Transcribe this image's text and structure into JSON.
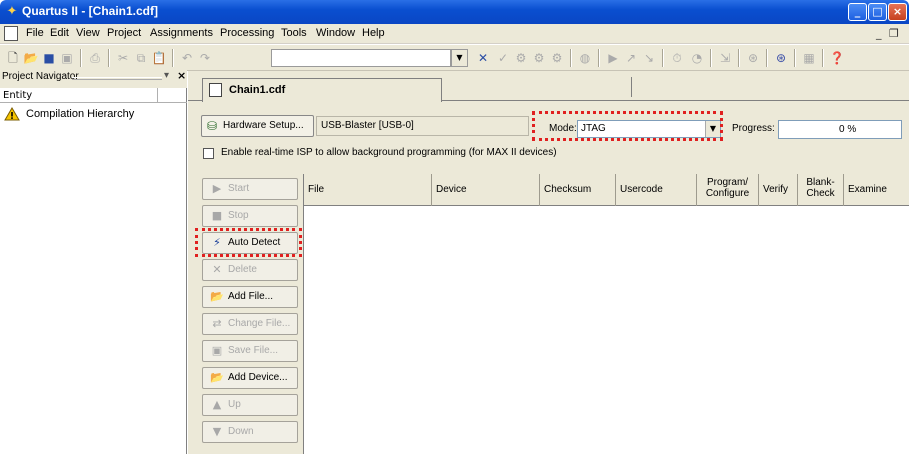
{
  "window": {
    "title": "Quartus II - [Chain1.cdf]"
  },
  "menu": [
    "File",
    "Edit",
    "View",
    "Project",
    "Assignments",
    "Processing",
    "Tools",
    "Window",
    "Help"
  ],
  "navigator": {
    "title": "Project Navigator",
    "column": "Entity",
    "items": [
      {
        "label": "Compilation Hierarchy",
        "icon": "warning-triangle-icon"
      }
    ]
  },
  "tab": {
    "label": "Chain1.cdf"
  },
  "programmer": {
    "hardware_setup_label": "Hardware Setup...",
    "hardware_value": "USB-Blaster [USB-0]",
    "mode_label": "Mode:",
    "mode_value": "JTAG",
    "progress_label": "Progress:",
    "progress_value": "0 %",
    "realtime_isp_label": "Enable real-time ISP to allow background programming (for MAX II devices)"
  },
  "side_buttons": [
    {
      "label": "Start",
      "icon": "start-icon",
      "enabled": false
    },
    {
      "label": "Stop",
      "icon": "stop-icon",
      "enabled": false
    },
    {
      "label": "Auto Detect",
      "icon": "auto-detect-icon",
      "enabled": true
    },
    {
      "label": "Delete",
      "icon": "delete-icon",
      "enabled": false
    },
    {
      "label": "Add File...",
      "icon": "add-file-icon",
      "enabled": true
    },
    {
      "label": "Change File...",
      "icon": "change-file-icon",
      "enabled": false
    },
    {
      "label": "Save File...",
      "icon": "save-file-icon",
      "enabled": false
    },
    {
      "label": "Add Device...",
      "icon": "add-device-icon",
      "enabled": true
    },
    {
      "label": "Up",
      "icon": "up-icon",
      "enabled": false
    },
    {
      "label": "Down",
      "icon": "down-icon",
      "enabled": false
    }
  ],
  "columns": [
    "File",
    "Device",
    "Checksum",
    "Usercode",
    "Program/ Configure",
    "Verify",
    "Blank- Check",
    "Examine"
  ],
  "colors": {
    "title_bar": "#0a4fd0",
    "highlight": "#e02020",
    "face": "#ece9d8"
  }
}
